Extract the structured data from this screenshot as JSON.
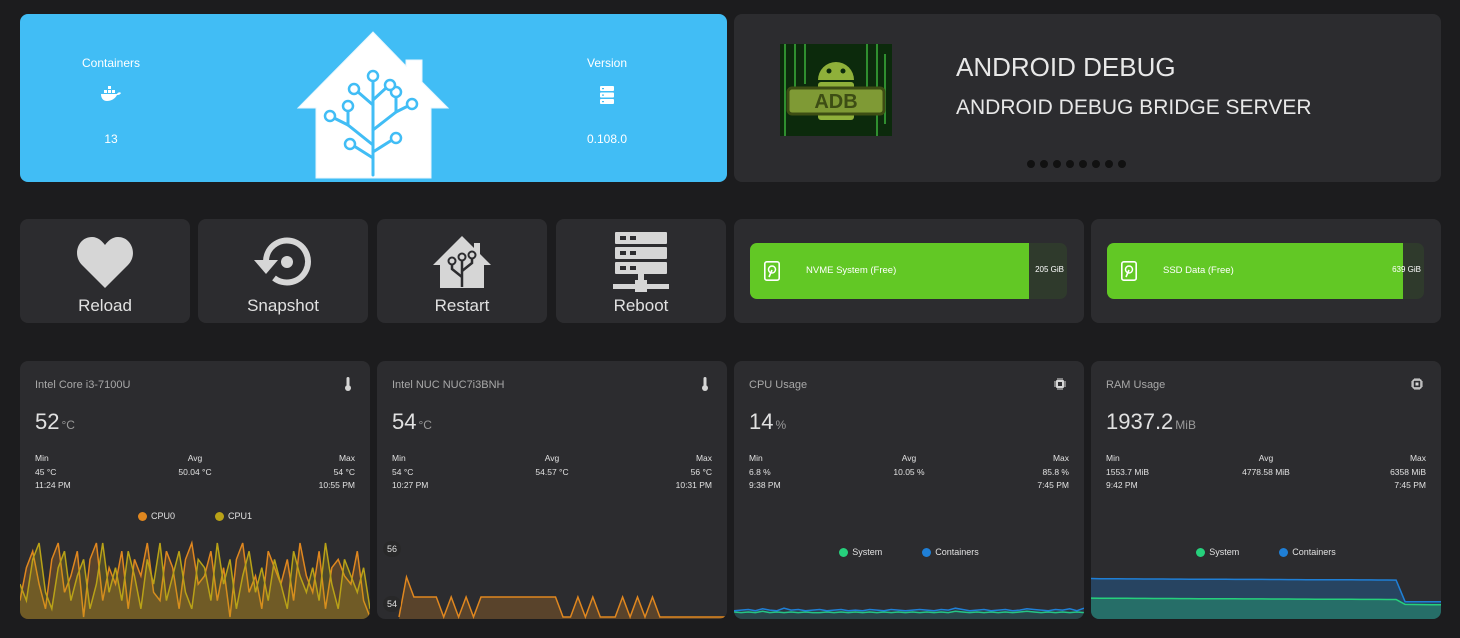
{
  "hero": {
    "containers_label": "Containers",
    "containers_value": "13",
    "containers_icon": "docker-icon",
    "version_label": "Version",
    "version_value": "0.108.0",
    "version_icon": "server-icon",
    "logo_icon": "home-assistant-logo"
  },
  "addon": {
    "title": "ANDROID DEBUG",
    "subtitle": "ANDROID DEBUG BRIDGE SERVER",
    "logo_icon": "adb-logo",
    "page_dots": 8
  },
  "actions": [
    {
      "label": "Reload",
      "icon": "heart-icon"
    },
    {
      "label": "Snapshot",
      "icon": "restore-icon"
    },
    {
      "label": "Restart",
      "icon": "home-assistant-icon"
    },
    {
      "label": "Reboot",
      "icon": "server-network-icon"
    }
  ],
  "storage": [
    {
      "name": "NVME System (Free)",
      "amount": "205 GiB",
      "fraction": 0.88,
      "icon": "harddisk-icon"
    },
    {
      "name": "SSD Data (Free)",
      "amount": "639 GiB",
      "fraction": 0.935,
      "icon": "harddisk-icon"
    }
  ],
  "sensors": [
    {
      "name": "Intel Core i3-7100U",
      "icon": "thermometer-icon",
      "value": "52",
      "unit": "°C",
      "min_label": "Min",
      "min_value": "45 °C",
      "min_time": "11:24 PM",
      "avg_label": "Avg",
      "avg_value": "50.04 °C",
      "max_label": "Max",
      "max_value": "54 °C",
      "max_time": "10:55 PM",
      "legend": [
        "CPU0",
        "CPU1"
      ]
    },
    {
      "name": "Intel NUC NUC7i3BNH",
      "icon": "thermometer-icon",
      "value": "54",
      "unit": "°C",
      "min_label": "Min",
      "min_value": "54 °C",
      "min_time": "10:27 PM",
      "avg_label": "Avg",
      "avg_value": "54.57 °C",
      "max_label": "Max",
      "max_value": "56 °C",
      "max_time": "10:31 PM",
      "y_top": "56",
      "y_bottom": "54"
    },
    {
      "name": "CPU Usage",
      "icon": "chip-icon",
      "value": "14",
      "unit": "%",
      "min_label": "Min",
      "min_value": "6.8 %",
      "min_time": "9:38 PM",
      "avg_label": "Avg",
      "avg_value": "10.05 %",
      "max_label": "Max",
      "max_value": "85.8 %",
      "max_time": "7:45 PM",
      "legend": [
        "System",
        "Containers"
      ]
    },
    {
      "name": "RAM Usage",
      "icon": "memory-icon",
      "value": "1937.2",
      "unit": "MiB",
      "min_label": "Min",
      "min_value": "1553.7 MiB",
      "min_time": "9:42 PM",
      "avg_label": "Avg",
      "avg_value": "4778.58 MiB",
      "max_label": "Max",
      "max_value": "6358 MiB",
      "max_time": "7:45 PM",
      "legend": [
        "System",
        "Containers"
      ]
    }
  ],
  "colors": {
    "accent": "#41bdf5",
    "storage_green": "#62c825",
    "cpu0": "#e0871f",
    "cpu1": "#b9a217",
    "system": "#26d07c",
    "containers": "#1f7fd6"
  },
  "chart_data": [
    {
      "type": "line",
      "series": [
        {
          "name": "CPU0",
          "values": [
            47,
            51,
            53,
            49,
            46,
            52,
            54,
            48,
            50,
            53,
            45,
            52,
            54,
            47,
            51,
            49,
            53,
            46,
            52,
            50,
            54,
            48,
            47,
            53,
            51,
            46,
            52,
            54,
            49,
            50,
            53,
            47,
            51,
            45,
            52,
            54,
            48,
            50,
            46,
            53,
            51,
            49,
            52,
            47,
            54,
            50,
            48,
            53,
            46,
            51,
            52,
            50,
            49,
            53,
            47,
            45
          ]
        },
        {
          "name": "CPU1",
          "values": [
            49,
            47,
            52,
            54,
            48,
            46,
            51,
            53,
            47,
            50,
            52,
            46,
            49,
            54,
            48,
            51,
            47,
            53,
            50,
            46,
            52,
            49,
            54,
            47,
            50,
            53,
            48,
            46,
            52,
            51,
            47,
            54,
            49,
            52,
            46,
            50,
            53,
            48,
            51,
            47,
            52,
            49,
            46,
            53,
            50,
            48,
            51,
            47,
            54,
            49,
            46,
            52,
            50,
            48,
            51,
            46
          ]
        }
      ]
    },
    {
      "type": "line",
      "series": [
        {
          "name": "Intel NUC NUC7i3BNH",
          "values": [
            54,
            56,
            55,
            55,
            55,
            55,
            54,
            55,
            54,
            55,
            54,
            55,
            55,
            55,
            55,
            55,
            55,
            55,
            55,
            55,
            55,
            55,
            54,
            54,
            55,
            54,
            55,
            54,
            54,
            54,
            55,
            54,
            55,
            54,
            55,
            54,
            54,
            54,
            54,
            54,
            54,
            54,
            54,
            54,
            54
          ]
        }
      ],
      "ylim": [
        54,
        56
      ]
    },
    {
      "type": "line",
      "series": [
        {
          "name": "System",
          "values": [
            8,
            7,
            8,
            7,
            9,
            7,
            8,
            7,
            8,
            7,
            8,
            7,
            7,
            8,
            7,
            8,
            7,
            8,
            7,
            8,
            7,
            8,
            7,
            8,
            7,
            8,
            7,
            8,
            7,
            8,
            7,
            9,
            8,
            7,
            8,
            7,
            8,
            7,
            8,
            7,
            8,
            9,
            8,
            7,
            8,
            7,
            8,
            7,
            8,
            7
          ]
        },
        {
          "name": "Containers",
          "values": [
            10,
            11,
            12,
            10,
            13,
            11,
            10,
            14,
            11,
            12,
            10,
            11,
            12,
            10,
            11,
            12,
            10,
            11,
            10,
            12,
            11,
            10,
            12,
            11,
            10,
            11,
            12,
            11,
            10,
            12,
            11,
            14,
            12,
            10,
            11,
            12,
            10,
            11,
            12,
            10,
            11,
            13,
            12,
            11,
            10,
            12,
            11,
            13,
            10,
            14
          ]
        }
      ]
    },
    {
      "type": "area",
      "series": [
        {
          "name": "System",
          "values": [
            4900,
            4880,
            4870,
            4860,
            4850,
            4850,
            4840,
            4830,
            4830,
            4820,
            4820,
            4810,
            4810,
            4800,
            4800,
            4800,
            4790,
            4790,
            4780,
            4780,
            4770,
            4770,
            4760,
            4760,
            4750,
            4750,
            4740,
            4740,
            4730,
            4730,
            4720,
            4720,
            4710,
            4710,
            4700,
            1950,
            1950,
            1945,
            1940,
            1937
          ]
        },
        {
          "name": "Containers",
          "values": [
            2400,
            2390,
            2385,
            2380,
            2375,
            2370,
            2365,
            2360,
            2355,
            2350,
            2345,
            2340,
            2335,
            2330,
            2325,
            2320,
            2315,
            2310,
            2305,
            2300,
            2295,
            2290,
            2285,
            2280,
            2275,
            2270,
            2265,
            2260,
            2255,
            2250,
            2245,
            2240,
            2235,
            2230,
            2225,
            1600,
            1590,
            1580,
            1570,
            1560
          ]
        }
      ]
    }
  ]
}
